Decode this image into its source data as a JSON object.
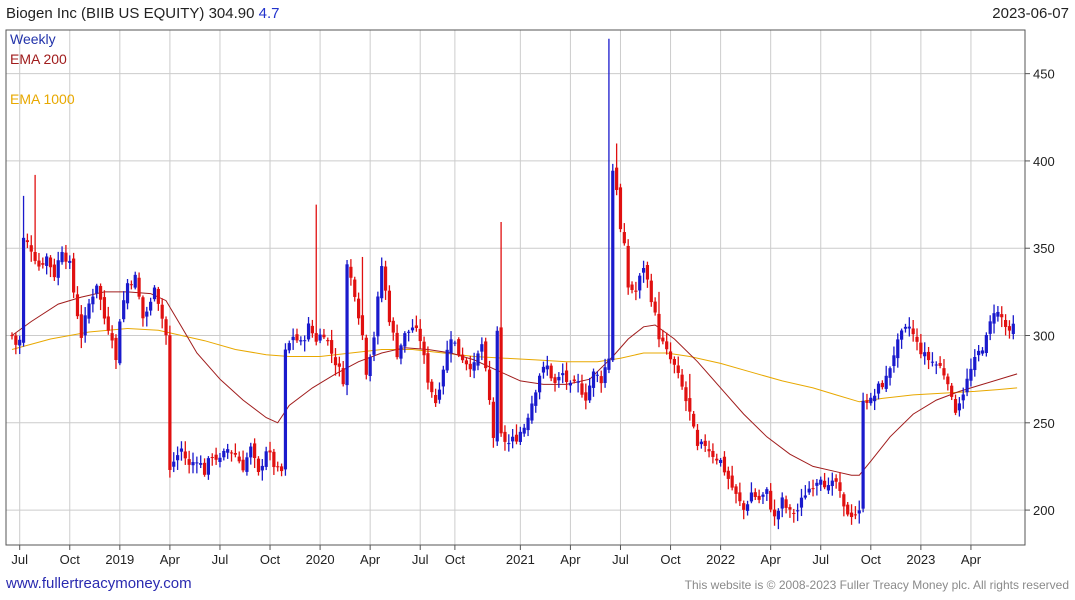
{
  "header": {
    "title": "Biogen Inc (BIIB US EQUITY) 304.90",
    "change": "4.7",
    "date": "2023-06-07"
  },
  "footer": {
    "site": "www.fullertreacymoney.com",
    "copyright": "This website is © 2008-2023 Fuller Treacy Money plc. All rights reserved"
  },
  "colors": {
    "up": "#1a1acc",
    "down": "#e01010",
    "ema200": "#a01c1c",
    "ema1000": "#e8a800",
    "grid": "#cccccc"
  },
  "chart_data": {
    "type": "candlestick",
    "ylim": [
      180,
      475
    ],
    "y_ticks": [
      200,
      250,
      300,
      350,
      400,
      450
    ],
    "x_range_weeks": [
      0,
      262
    ],
    "x_ticks": [
      {
        "label": "Jul",
        "week": 2
      },
      {
        "label": "Oct",
        "week": 15
      },
      {
        "label": "2019",
        "week": 28
      },
      {
        "label": "Apr",
        "week": 41
      },
      {
        "label": "Jul",
        "week": 54
      },
      {
        "label": "Oct",
        "week": 67
      },
      {
        "label": "2020",
        "week": 80
      },
      {
        "label": "Apr",
        "week": 93
      },
      {
        "label": "Jul",
        "week": 106
      },
      {
        "label": "Oct",
        "week": 115
      },
      {
        "label": "2021",
        "week": 132
      },
      {
        "label": "Apr",
        "week": 145
      },
      {
        "label": "Jul",
        "week": 158
      },
      {
        "label": "Oct",
        "week": 171
      },
      {
        "label": "2022",
        "week": 184
      },
      {
        "label": "Apr",
        "week": 197
      },
      {
        "label": "Jul",
        "week": 210
      },
      {
        "label": "Oct",
        "week": 223
      },
      {
        "label": "2023",
        "week": 236
      },
      {
        "label": "Apr",
        "week": 249
      }
    ],
    "legend": [
      {
        "label": "Weekly",
        "color": "#2233aa"
      },
      {
        "label": "EMA 200",
        "color": "#a01c1c"
      },
      {
        "label": "EMA 1000",
        "color": "#e8a800"
      }
    ],
    "series": [
      {
        "name": "Weekly",
        "close_anchors": [
          [
            0,
            300
          ],
          [
            1,
            295
          ],
          [
            2,
            297
          ],
          [
            3,
            355
          ],
          [
            5,
            350
          ],
          [
            7,
            340
          ],
          [
            9,
            345
          ],
          [
            11,
            335
          ],
          [
            13,
            350
          ],
          [
            15,
            340
          ],
          [
            16,
            325
          ],
          [
            18,
            300
          ],
          [
            20,
            318
          ],
          [
            22,
            330
          ],
          [
            24,
            310
          ],
          [
            26,
            300
          ],
          [
            27,
            285
          ],
          [
            28,
            310
          ],
          [
            30,
            330
          ],
          [
            32,
            333
          ],
          [
            34,
            310
          ],
          [
            36,
            318
          ],
          [
            37,
            330
          ],
          [
            38,
            320
          ],
          [
            40,
            300
          ],
          [
            41,
            222
          ],
          [
            42,
            228
          ],
          [
            44,
            235
          ],
          [
            46,
            225
          ],
          [
            48,
            230
          ],
          [
            50,
            222
          ],
          [
            52,
            232
          ],
          [
            54,
            228
          ],
          [
            56,
            235
          ],
          [
            58,
            232
          ],
          [
            60,
            225
          ],
          [
            62,
            235
          ],
          [
            64,
            220
          ],
          [
            66,
            235
          ],
          [
            68,
            226
          ],
          [
            69,
            222
          ],
          [
            70,
            222
          ],
          [
            71,
            290
          ],
          [
            73,
            300
          ],
          [
            75,
            295
          ],
          [
            77,
            305
          ],
          [
            79,
            298
          ],
          [
            81,
            302
          ],
          [
            83,
            290
          ],
          [
            85,
            280
          ],
          [
            86,
            275
          ],
          [
            87,
            340
          ],
          [
            89,
            325
          ],
          [
            91,
            300
          ],
          [
            92,
            280
          ],
          [
            94,
            300
          ],
          [
            96,
            340
          ],
          [
            98,
            310
          ],
          [
            100,
            290
          ],
          [
            102,
            300
          ],
          [
            104,
            305
          ],
          [
            106,
            298
          ],
          [
            108,
            275
          ],
          [
            110,
            262
          ],
          [
            112,
            282
          ],
          [
            114,
            300
          ],
          [
            116,
            290
          ],
          [
            118,
            285
          ],
          [
            120,
            282
          ],
          [
            122,
            295
          ],
          [
            124,
            262
          ],
          [
            125,
            242
          ],
          [
            126,
            300
          ],
          [
            127,
            242
          ],
          [
            129,
            238
          ],
          [
            131,
            242
          ],
          [
            133,
            248
          ],
          [
            135,
            262
          ],
          [
            137,
            278
          ],
          [
            139,
            282
          ],
          [
            141,
            272
          ],
          [
            143,
            278
          ],
          [
            145,
            270
          ],
          [
            147,
            272
          ],
          [
            149,
            265
          ],
          [
            151,
            278
          ],
          [
            153,
            275
          ],
          [
            155,
            288
          ],
          [
            156,
            395
          ],
          [
            157,
            385
          ],
          [
            158,
            360
          ],
          [
            159,
            350
          ],
          [
            160,
            328
          ],
          [
            162,
            325
          ],
          [
            164,
            340
          ],
          [
            166,
            322
          ],
          [
            168,
            300
          ],
          [
            170,
            290
          ],
          [
            172,
            282
          ],
          [
            174,
            270
          ],
          [
            176,
            255
          ],
          [
            178,
            235
          ],
          [
            180,
            238
          ],
          [
            182,
            232
          ],
          [
            184,
            228
          ],
          [
            186,
            218
          ],
          [
            188,
            208
          ],
          [
            190,
            200
          ],
          [
            192,
            210
          ],
          [
            194,
            206
          ],
          [
            196,
            210
          ],
          [
            198,
            195
          ],
          [
            200,
            205
          ],
          [
            202,
            198
          ],
          [
            204,
            200
          ],
          [
            206,
            210
          ],
          [
            208,
            215
          ],
          [
            210,
            220
          ],
          [
            212,
            212
          ],
          [
            214,
            216
          ],
          [
            216,
            200
          ],
          [
            218,
            198
          ],
          [
            219,
            198
          ],
          [
            220,
            198
          ],
          [
            221,
            265
          ],
          [
            223,
            262
          ],
          [
            225,
            270
          ],
          [
            227,
            275
          ],
          [
            229,
            290
          ],
          [
            231,
            300
          ],
          [
            233,
            305
          ],
          [
            235,
            295
          ],
          [
            237,
            288
          ],
          [
            239,
            285
          ],
          [
            241,
            282
          ],
          [
            243,
            275
          ],
          [
            244,
            262
          ],
          [
            245,
            258
          ],
          [
            247,
            268
          ],
          [
            249,
            280
          ],
          [
            251,
            290
          ],
          [
            253,
            298
          ],
          [
            255,
            315
          ],
          [
            257,
            310
          ],
          [
            259,
            300
          ],
          [
            260,
            305
          ]
        ]
      },
      {
        "name": "EMA 200",
        "points": [
          [
            0,
            300
          ],
          [
            5,
            308
          ],
          [
            12,
            318
          ],
          [
            18,
            322
          ],
          [
            24,
            325
          ],
          [
            30,
            325
          ],
          [
            36,
            324
          ],
          [
            40,
            320
          ],
          [
            44,
            305
          ],
          [
            48,
            290
          ],
          [
            54,
            275
          ],
          [
            60,
            263
          ],
          [
            66,
            253
          ],
          [
            69,
            250
          ],
          [
            72,
            260
          ],
          [
            78,
            270
          ],
          [
            84,
            278
          ],
          [
            90,
            285
          ],
          [
            96,
            290
          ],
          [
            102,
            293
          ],
          [
            108,
            292
          ],
          [
            114,
            290
          ],
          [
            120,
            286
          ],
          [
            126,
            280
          ],
          [
            132,
            274
          ],
          [
            138,
            272
          ],
          [
            144,
            272
          ],
          [
            150,
            275
          ],
          [
            156,
            288
          ],
          [
            160,
            298
          ],
          [
            164,
            305
          ],
          [
            167,
            306
          ],
          [
            172,
            298
          ],
          [
            178,
            285
          ],
          [
            184,
            270
          ],
          [
            190,
            255
          ],
          [
            196,
            242
          ],
          [
            202,
            232
          ],
          [
            208,
            225
          ],
          [
            214,
            222
          ],
          [
            218,
            220
          ],
          [
            220,
            220
          ],
          [
            223,
            228
          ],
          [
            228,
            242
          ],
          [
            234,
            255
          ],
          [
            240,
            263
          ],
          [
            246,
            268
          ],
          [
            252,
            272
          ],
          [
            258,
            276
          ],
          [
            261,
            278
          ]
        ]
      },
      {
        "name": "EMA 1000",
        "points": [
          [
            0,
            292
          ],
          [
            10,
            298
          ],
          [
            20,
            302
          ],
          [
            30,
            304
          ],
          [
            38,
            303
          ],
          [
            44,
            300
          ],
          [
            50,
            297
          ],
          [
            58,
            292
          ],
          [
            66,
            289
          ],
          [
            72,
            288
          ],
          [
            80,
            288
          ],
          [
            88,
            290
          ],
          [
            96,
            292
          ],
          [
            104,
            292
          ],
          [
            112,
            290
          ],
          [
            120,
            288
          ],
          [
            128,
            287
          ],
          [
            136,
            286
          ],
          [
            144,
            285
          ],
          [
            152,
            285
          ],
          [
            158,
            287
          ],
          [
            164,
            290
          ],
          [
            170,
            290
          ],
          [
            176,
            288
          ],
          [
            184,
            284
          ],
          [
            192,
            279
          ],
          [
            200,
            274
          ],
          [
            208,
            270
          ],
          [
            214,
            266
          ],
          [
            220,
            262
          ],
          [
            226,
            264
          ],
          [
            234,
            266
          ],
          [
            242,
            267
          ],
          [
            250,
            268
          ],
          [
            256,
            269
          ],
          [
            261,
            270
          ]
        ]
      }
    ]
  }
}
